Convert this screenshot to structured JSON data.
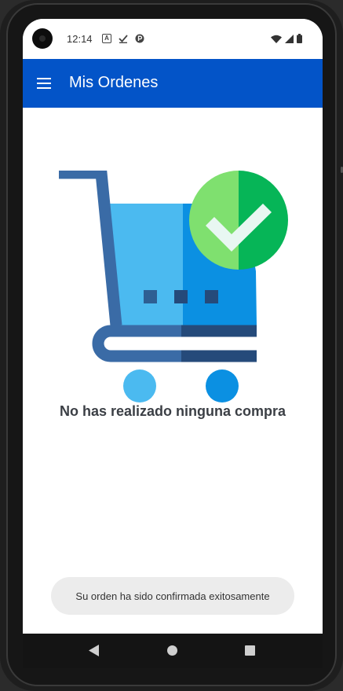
{
  "status_bar": {
    "time": "12:14",
    "left_icons": [
      "a-box-icon",
      "check-icon",
      "p-circle-icon"
    ],
    "right_icons": [
      "wifi-icon",
      "signal-icon",
      "battery-icon"
    ]
  },
  "app_bar": {
    "title": "Mis Ordenes",
    "menu_icon": "hamburger-menu-icon"
  },
  "main": {
    "illustration_icon": "cart-check-icon",
    "empty_message": "No has realizado ninguna compra"
  },
  "toast": {
    "message": "Su orden ha sido confirmada exitosamente"
  },
  "nav_bar": {
    "icons": [
      "back-icon",
      "home-icon",
      "recents-icon"
    ]
  },
  "colors": {
    "app_bar": "#0354c8",
    "cart_light": "#4bbaf0",
    "cart_dark": "#0b90e2",
    "cart_frame": "#3a6ba6",
    "check_green_light": "#7fe06f",
    "check_green_dark": "#06b557"
  }
}
